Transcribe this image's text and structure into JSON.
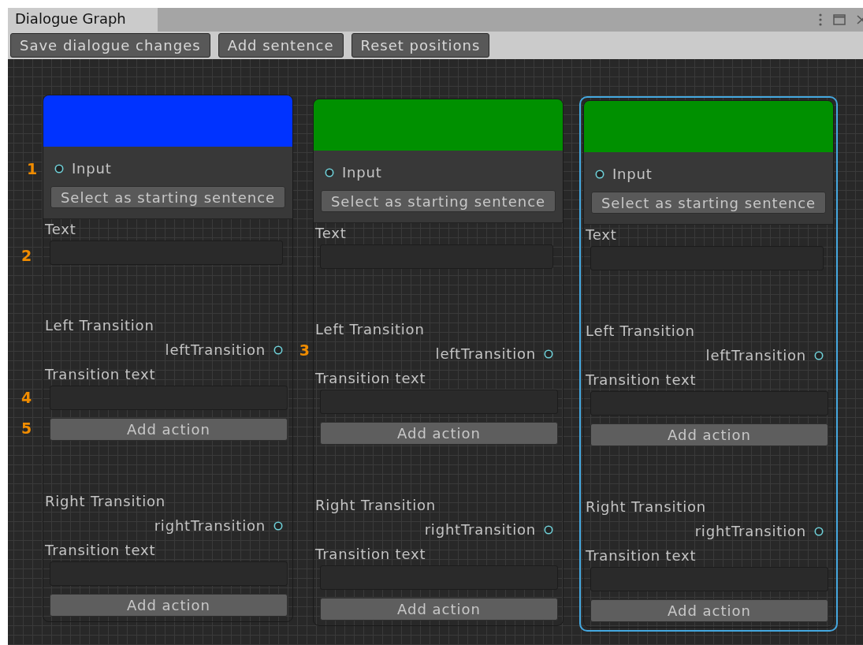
{
  "window": {
    "title": "Dialogue Graph"
  },
  "toolbar": [
    "Save dialogue changes",
    "Add sentence",
    "Reset positions"
  ],
  "nodes": [
    {
      "color": "#0033ff",
      "selected": false,
      "input": "Input",
      "input_note": "1",
      "start_button": "Select as starting sentence",
      "text_label": "Text",
      "text_note": "2",
      "transitions": [
        {
          "heading": "Left Transition",
          "port": "leftTransition",
          "port_note": "3",
          "text_label": "Transition text",
          "field_note": "4",
          "button": "Add action",
          "button_note": "5"
        },
        {
          "heading": "Right Transition",
          "port": "rightTransition",
          "text_label": "Transition text",
          "button": "Add action"
        }
      ]
    },
    {
      "color": "#009000",
      "selected": false,
      "input": "Input",
      "start_button": "Select as starting sentence",
      "text_label": "Text",
      "transitions": [
        {
          "heading": "Left Transition",
          "port": "leftTransition",
          "text_label": "Transition text",
          "button": "Add action"
        },
        {
          "heading": "Right Transition",
          "port": "rightTransition",
          "text_label": "Transition text",
          "button": "Add action"
        }
      ]
    },
    {
      "color": "#009000",
      "selected": true,
      "input": "Input",
      "start_button": "Select as starting sentence",
      "text_label": "Text",
      "transitions": [
        {
          "heading": "Left Transition",
          "port": "leftTransition",
          "text_label": "Transition text",
          "button": "Add action"
        },
        {
          "heading": "Right Transition",
          "port": "rightTransition",
          "text_label": "Transition text",
          "button": "Add action"
        }
      ]
    }
  ]
}
